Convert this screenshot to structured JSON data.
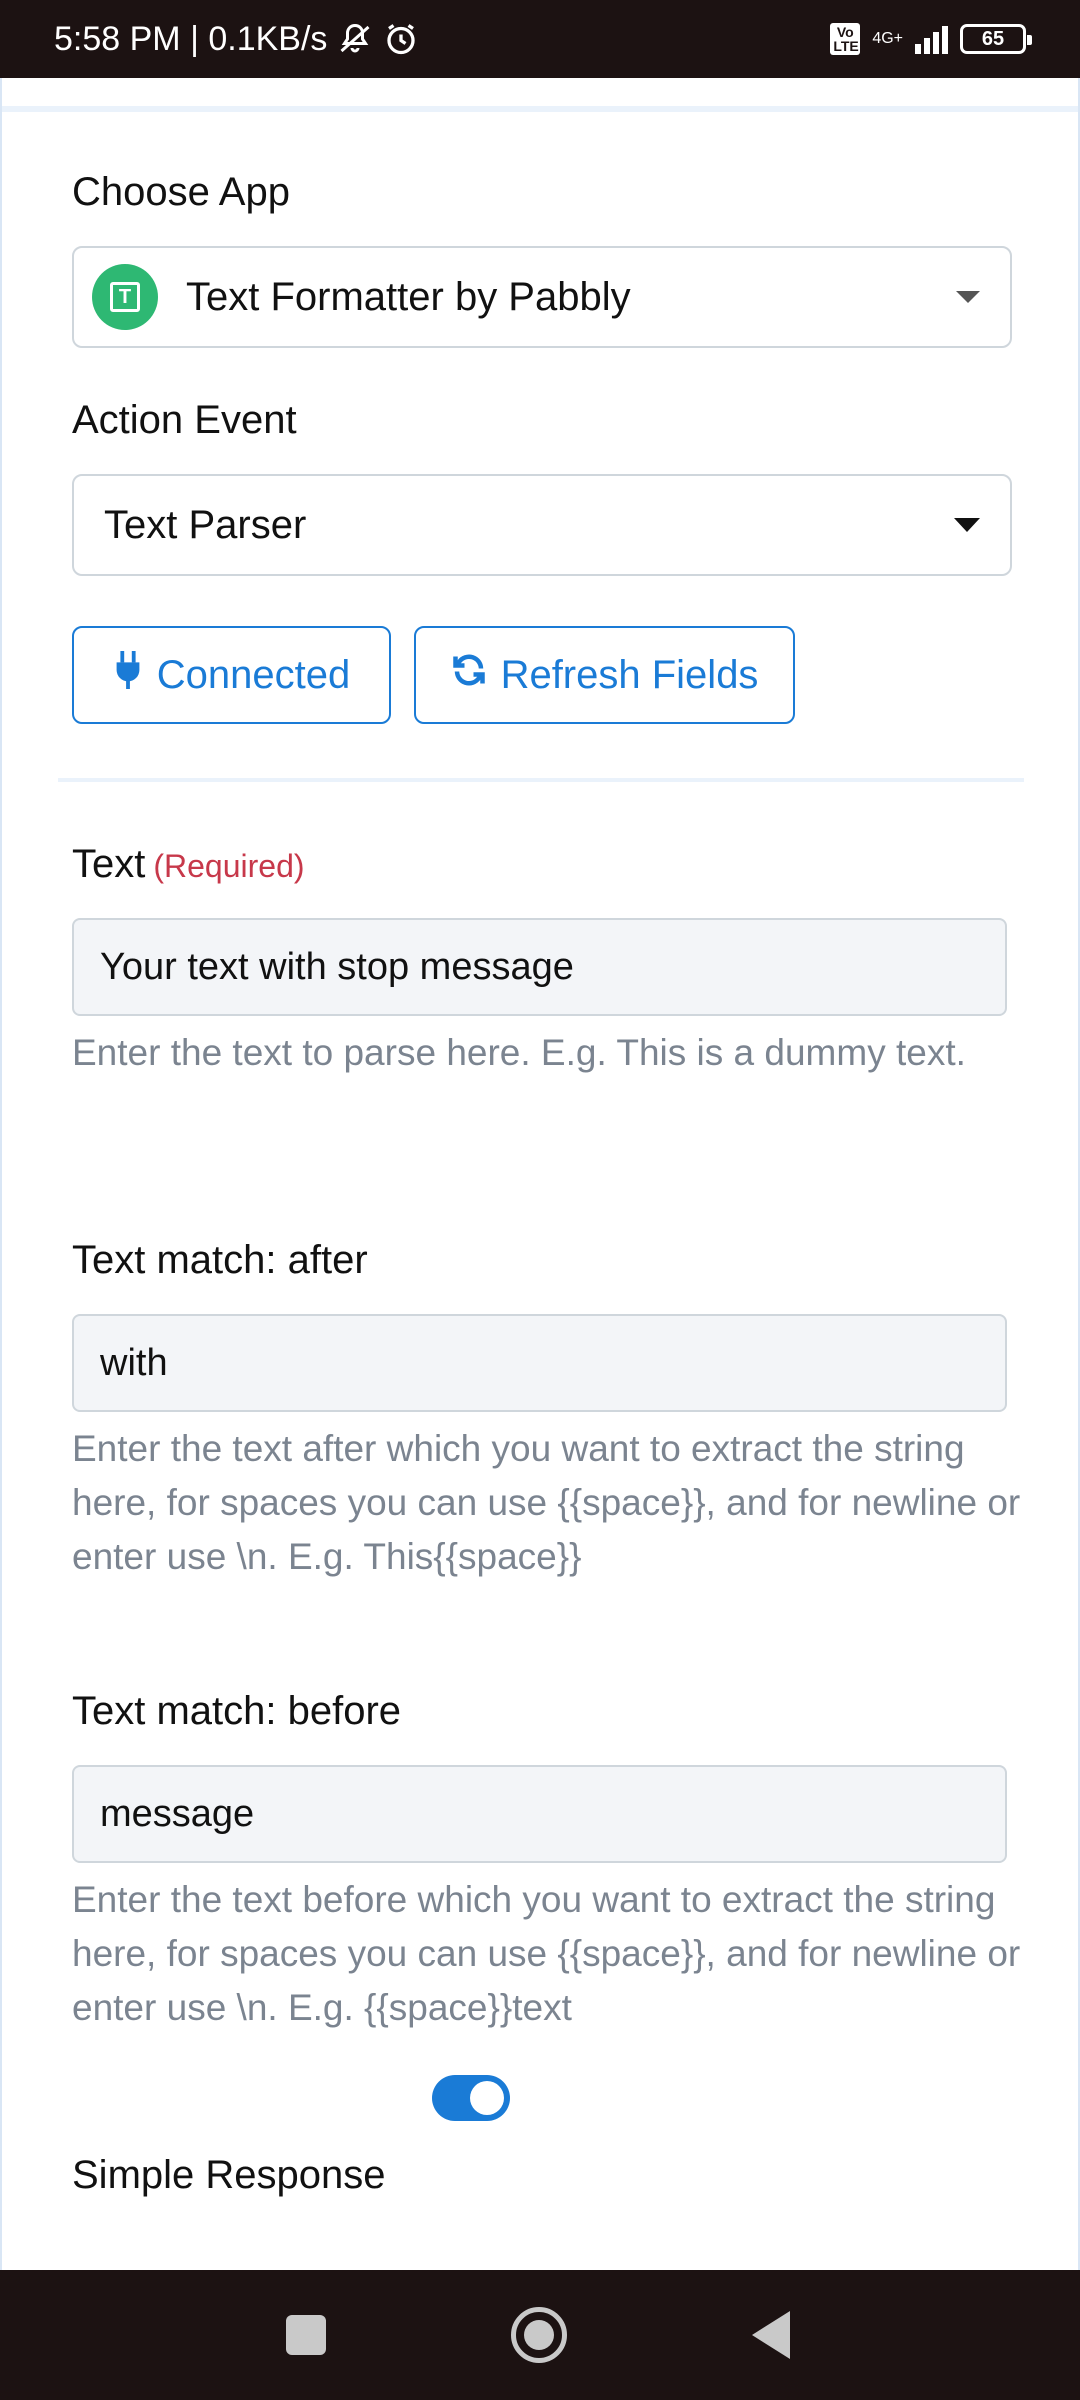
{
  "status_bar": {
    "time_speed": "5:58 PM | 0.1KB/s",
    "volte": "Vo LTE",
    "network": "4G+",
    "battery": "65"
  },
  "form": {
    "choose_app_label": "Choose App",
    "app_name": "Text Formatter by Pabbly",
    "app_icon_letter": "T",
    "action_event_label": "Action Event",
    "action_event_value": "Text Parser",
    "connected_label": "Connected",
    "refresh_label": "Refresh Fields",
    "text_label": "Text",
    "required_label": "(Required)",
    "text_value": "Your text with stop message",
    "text_help": "Enter the text to parse here. E.g. This is a dummy text.",
    "after_label": "Text match: after",
    "after_value": "with",
    "after_help": "Enter the text after which you want to extract the string here, for spaces you can use {{space}}, and for newline or enter use \\n. E.g. This{{space}}",
    "before_label": "Text match: before",
    "before_value": "message",
    "before_help": "Enter the text before which you want to extract the string here, for spaces you can use {{space}}, and for newline or enter use \\n. E.g. {{space}}text",
    "simple_response_label": "Simple Response",
    "simple_response_on": true
  },
  "colors": {
    "accent": "#1a7bd6",
    "required": "#c7384a",
    "app_logo": "#2eb873"
  }
}
